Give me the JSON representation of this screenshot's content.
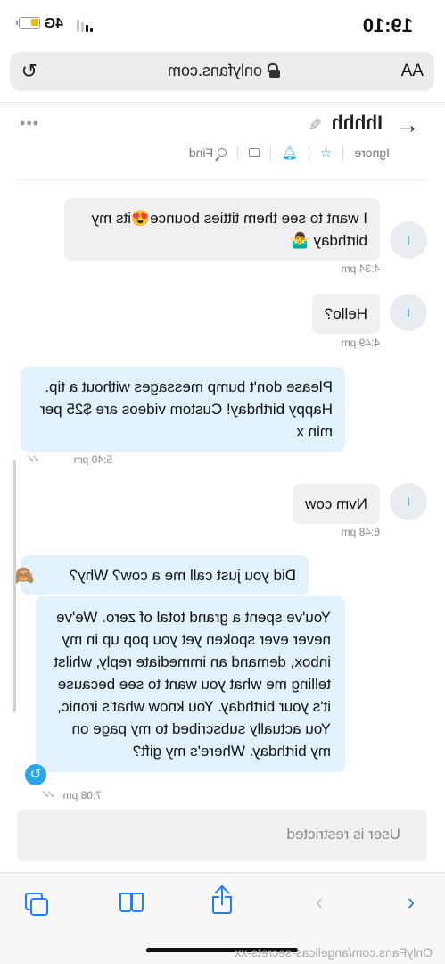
{
  "status_bar": {
    "time": "19:10",
    "network": "4G"
  },
  "browser": {
    "text_size_label": "AA",
    "url": "onlyfans.com"
  },
  "chat": {
    "name": "Ihhhh",
    "actions": {
      "ignore": "Ignore",
      "find": "Find"
    }
  },
  "messages": [
    {
      "direction": "incoming",
      "avatar_letter": "I",
      "text": "I want to see them titties bounce",
      "emoji": "😍",
      "text_cont": "its my birthday",
      "emoji2": "🤷‍♂️",
      "time": "4:34 pm"
    },
    {
      "direction": "incoming",
      "avatar_letter": "I",
      "text": "Hello?",
      "time": "4:49 pm"
    },
    {
      "direction": "outgoing",
      "text": "Please don't bump messages without a tip. Happy birthday! Custom videos are $25 per min x",
      "time": "5:40 pm"
    },
    {
      "direction": "incoming",
      "avatar_letter": "I",
      "text": "Nvm cow",
      "time": "6:48 pm"
    },
    {
      "direction": "outgoing",
      "text": "Did you just call me a cow? Why?",
      "emoji": "🙈"
    },
    {
      "direction": "outgoing",
      "text": "You've spent a grand total of zero. We've never ever spoken yet you pop up in my inbox, demand an immediate reply, whilst telling me what you want to see because it's your birthday. You know what's ironic, You actually subscribed to my page on my birthday. Where's my gift?",
      "time": "7:08 pm"
    }
  ],
  "input": {
    "placeholder": "User is restricted"
  },
  "watermark": "OnlyFans.com/angelicas-secrets-xx",
  "colors": {
    "accent": "#2aa7e8",
    "safari_blue": "#1f7ff5",
    "outgoing_bubble": "#e2f2fc",
    "incoming_bubble": "#f0f0f2"
  }
}
